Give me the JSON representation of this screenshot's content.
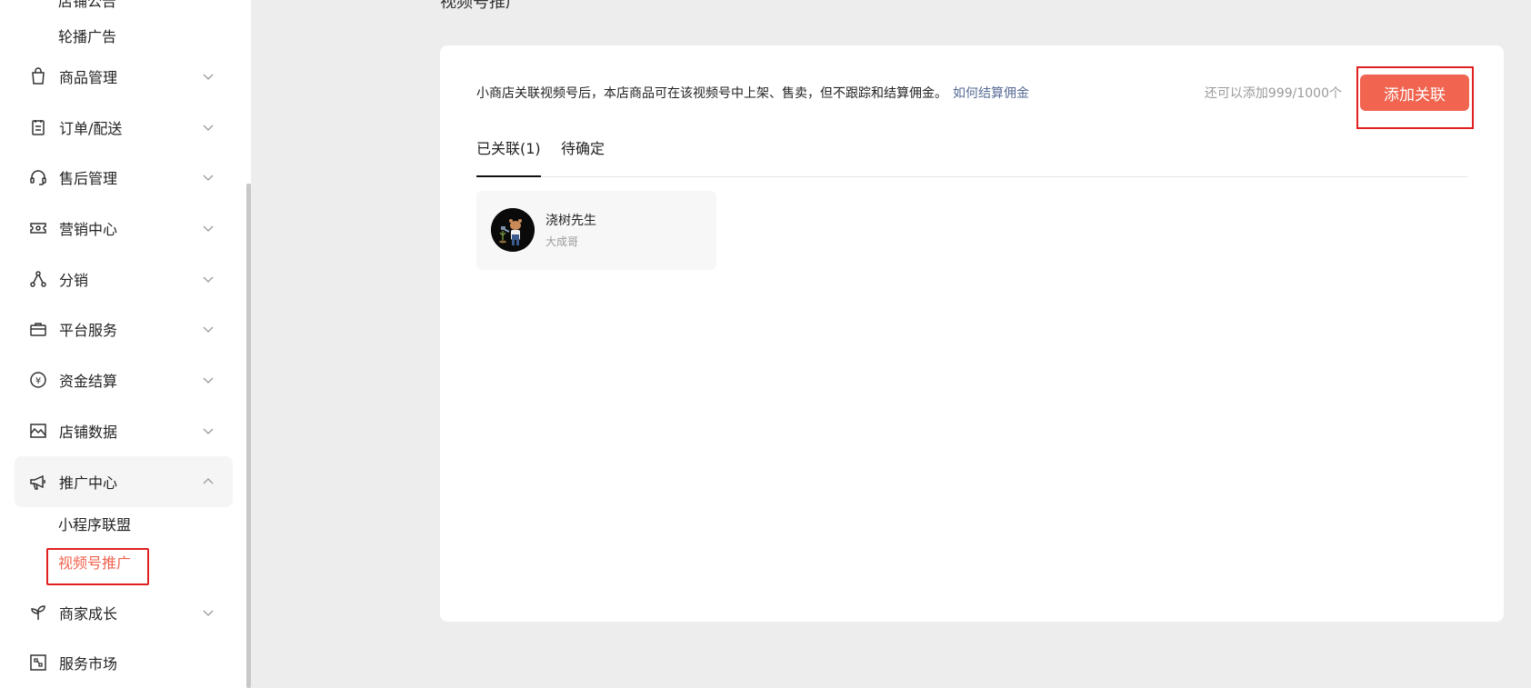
{
  "sidebar": {
    "top_items": [
      {
        "label": "店铺公告"
      },
      {
        "label": "轮播广告"
      }
    ],
    "menu": [
      {
        "label": "商品管理",
        "icon": "bag-icon"
      },
      {
        "label": "订单/配送",
        "icon": "clipboard-icon"
      },
      {
        "label": "售后管理",
        "icon": "headset-icon"
      },
      {
        "label": "营销中心",
        "icon": "ticket-icon"
      },
      {
        "label": "分销",
        "icon": "share-nodes-icon"
      },
      {
        "label": "平台服务",
        "icon": "briefcase-icon"
      },
      {
        "label": "资金结算",
        "icon": "yen-icon"
      },
      {
        "label": "店铺数据",
        "icon": "chart-icon"
      },
      {
        "label": "推广中心",
        "icon": "megaphone-icon"
      },
      {
        "label": "商家成长",
        "icon": "sprout-icon"
      },
      {
        "label": "服务市场",
        "icon": "puzzle-icon"
      }
    ],
    "promo_sub": [
      {
        "label": "小程序联盟"
      },
      {
        "label": "视频号推广"
      }
    ]
  },
  "main": {
    "page_title_partial": "视频号推广",
    "description": "小商店关联视频号后，本店商品可在该视频号中上架、售卖，但不跟踪和结算佣金。",
    "help_link": "如何结算佣金",
    "quota_text": "还可以添加999/1000个",
    "add_button": "添加关联",
    "tabs": [
      {
        "label": "已关联(1)"
      },
      {
        "label": "待确定"
      }
    ],
    "account": {
      "name": "浇树先生",
      "sub": "大成哥"
    }
  },
  "colors": {
    "accent": "#f06450",
    "highlight_border": "#e02020",
    "link": "#576b95"
  }
}
